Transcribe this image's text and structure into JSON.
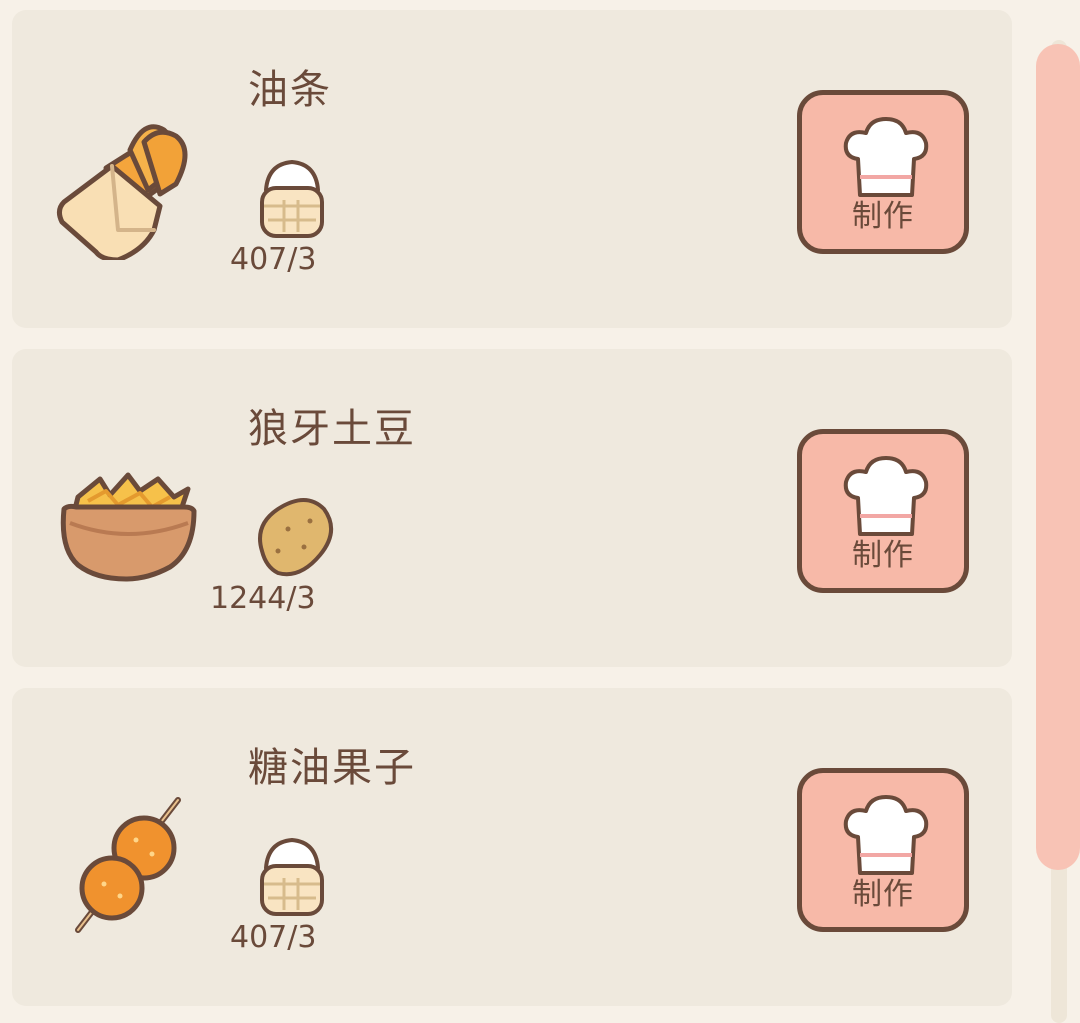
{
  "recipes": [
    {
      "name": "油条",
      "dish_icon": "youtiao-icon",
      "ingredient_icon": "flour-basket-icon",
      "ingredient_count": "407/3",
      "button_label": "制作"
    },
    {
      "name": "狼牙土豆",
      "dish_icon": "crinkle-potato-icon",
      "ingredient_icon": "potato-icon",
      "ingredient_count": "1244/3",
      "button_label": "制作"
    },
    {
      "name": "糖油果子",
      "dish_icon": "sugar-fried-ball-skewer-icon",
      "ingredient_icon": "flour-basket-icon",
      "ingredient_count": "407/3",
      "button_label": "制作"
    }
  ],
  "scrollbar": {
    "visible_fraction": 0.84
  },
  "colors": {
    "card_bg": "#efe9de",
    "button_bg": "#f7b9a8",
    "outline": "#6a4a3a",
    "scroll_thumb": "#f8c3b5"
  }
}
